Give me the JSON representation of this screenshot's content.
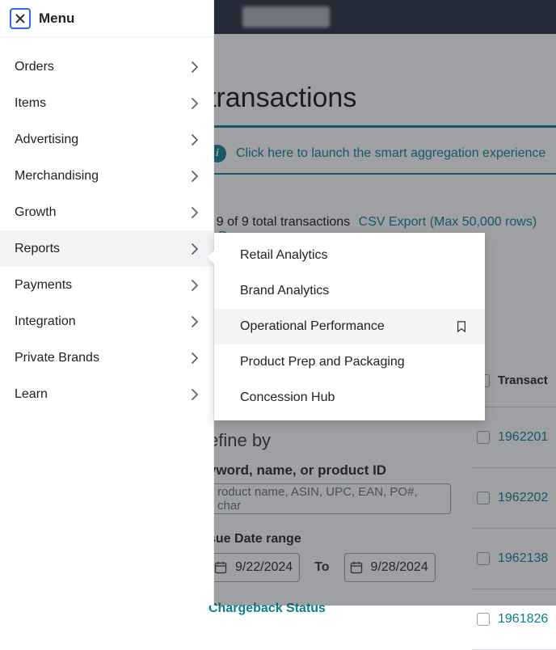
{
  "topbar": {},
  "page": {
    "title_fragment": "transactions",
    "info_text": "Click here to launch the smart aggregation experience",
    "count_fragment": "- 9 of 9 total transactions",
    "csv_text": "CSV Export (Max 50,000 rows)",
    "down_text": "Down"
  },
  "refine": {
    "title_fragment": "efine by",
    "search_label": "yword, name, or product ID",
    "search_placeholder": "roduct name, ASIN, UPC, EAN, PO#, char",
    "issue_label": "sue Date range",
    "date_from": "9/22/2024",
    "date_to": "9/28/2024",
    "to_label": "To",
    "chargeback_label": "Chargeback Status"
  },
  "table": {
    "header": "Transact",
    "rows": [
      "1962201",
      "1962202",
      "1962138",
      "1961826"
    ]
  },
  "menu": {
    "header": "Menu",
    "items": [
      {
        "label": "Orders"
      },
      {
        "label": "Items"
      },
      {
        "label": "Advertising"
      },
      {
        "label": "Merchandising"
      },
      {
        "label": "Growth"
      },
      {
        "label": "Reports",
        "active": true
      },
      {
        "label": "Payments"
      },
      {
        "label": "Integration"
      },
      {
        "label": "Private Brands"
      },
      {
        "label": "Learn"
      }
    ]
  },
  "submenu": {
    "items": [
      {
        "label": "Retail Analytics"
      },
      {
        "label": "Brand Analytics"
      },
      {
        "label": "Operational Performance",
        "hover": true
      },
      {
        "label": "Product Prep and Packaging"
      },
      {
        "label": "Concession Hub"
      }
    ]
  }
}
